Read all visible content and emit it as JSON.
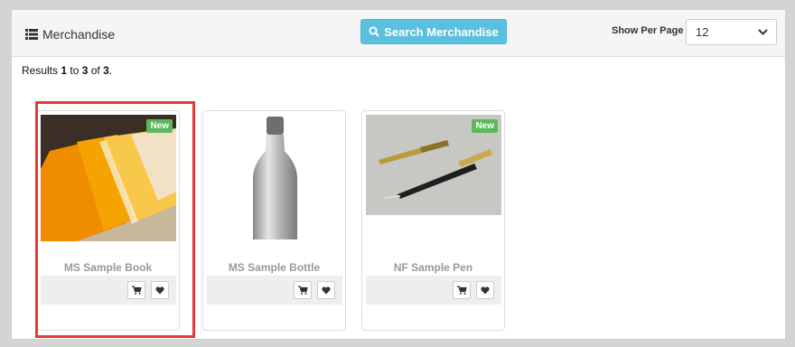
{
  "header": {
    "title": "Merchandise",
    "search_button": "Search Merchandise",
    "per_page_label": "Show Per Page",
    "per_page_value": "12"
  },
  "results": {
    "prefix": "Results ",
    "from": "1",
    "to_word": " to ",
    "to": "3",
    "of_word": " of ",
    "total": "3",
    "suffix": "."
  },
  "products": [
    {
      "name": "MS Sample Book",
      "badge": "New",
      "image": "book-photo"
    },
    {
      "name": "MS Sample Bottle",
      "badge": "",
      "image": "bottle-photo"
    },
    {
      "name": "NF Sample Pen",
      "badge": "New",
      "image": "pen-photo"
    }
  ],
  "colors": {
    "accent": "#5bc0de",
    "badge": "#5cb85c",
    "highlight": "#e53935"
  }
}
